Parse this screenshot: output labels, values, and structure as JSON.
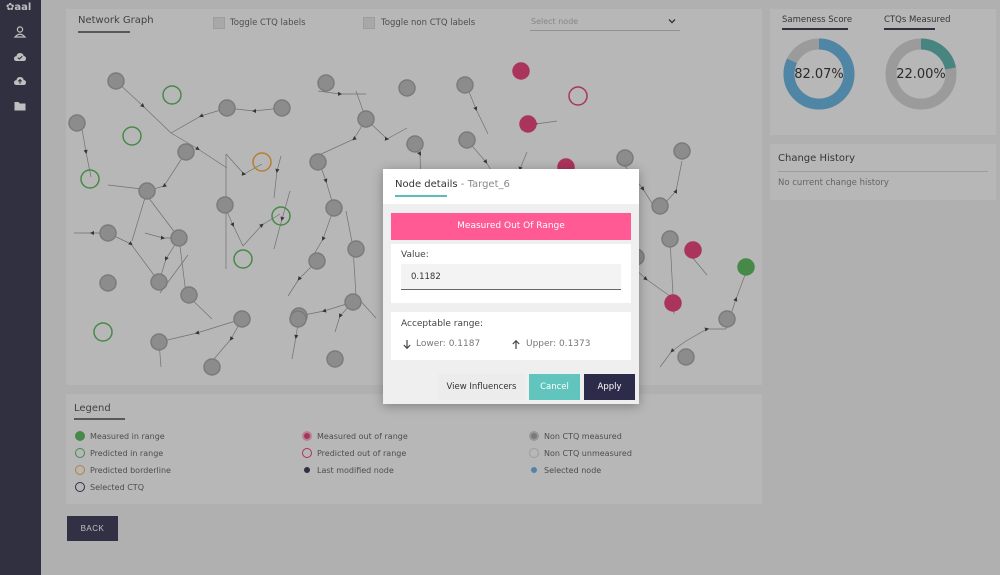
{
  "app": {
    "logo": "aal"
  },
  "graph": {
    "title": "Network Graph",
    "toggle_ctq": "Toggle CTQ labels",
    "toggle_non_ctq": "Toggle non CTQ labels",
    "select_placeholder": "Select node"
  },
  "legend": {
    "title": "Legend",
    "items": [
      {
        "label": "Measured in range",
        "kind": "measured-in-range",
        "color": "#4caf50"
      },
      {
        "label": "Predicted in range",
        "kind": "predicted-in-range",
        "color": "#4caf50"
      },
      {
        "label": "Predicted borderline",
        "kind": "predicted-borderline",
        "color": "#f0a030"
      },
      {
        "label": "Selected CTQ",
        "kind": "selected-ctq",
        "color": "#2b2a44"
      },
      {
        "label": "Measured out of range",
        "kind": "measured-out-of-range",
        "color": "#e0306a"
      },
      {
        "label": "Predicted out of range",
        "kind": "predicted-out-of-range",
        "color": "#e0306a"
      },
      {
        "label": "Last modified node",
        "kind": "last-modified",
        "color": "#2b2a44"
      },
      {
        "label": "Non CTQ measured",
        "kind": "non-ctq-measured",
        "color": "#999999"
      },
      {
        "label": "Non CTQ unmeasured",
        "kind": "non-ctq-unmeasured",
        "color": "#cccccc"
      },
      {
        "label": "Selected node",
        "kind": "selected-node",
        "color": "#5aaad8"
      }
    ]
  },
  "back_label": "BACK",
  "scores": {
    "sameness_label": "Sameness Score",
    "sameness_value": "82.07%",
    "sameness_fraction": 0.8207,
    "ctq_label": "CTQs Measured",
    "ctq_value": "22.00%",
    "ctq_fraction": 0.22
  },
  "history": {
    "title": "Change History",
    "empty": "No current change history"
  },
  "modal": {
    "title": "Node details",
    "separator": " - ",
    "node": "Target_6",
    "status": "Measured Out Of Range",
    "value_label": "Value:",
    "value": "0.1182",
    "range_label": "Acceptable range:",
    "lower": "Lower: 0.1187",
    "upper": "Upper: 0.1373",
    "btn_influencers": "View Influencers",
    "btn_cancel": "Cancel",
    "btn_apply": "Apply"
  },
  "colors": {
    "accent_teal": "#5bbdb7",
    "status_pink": "#ff5a93",
    "sidebar": "#2b2a44",
    "donut_blue": "#5aaad8",
    "donut_teal": "#4ea8a2"
  }
}
